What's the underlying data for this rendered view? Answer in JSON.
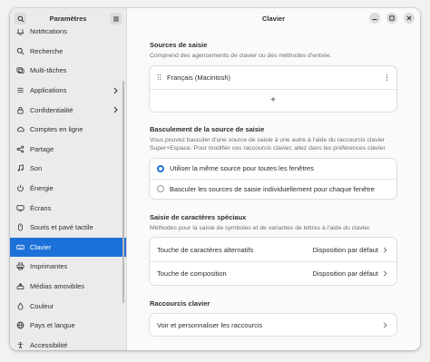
{
  "sidebar": {
    "title": "Paramètres",
    "items": [
      {
        "label": "Notifications",
        "icon": "bell-icon",
        "chevron": false
      },
      {
        "label": "Recherche",
        "icon": "search-icon",
        "chevron": false
      },
      {
        "label": "Multi-tâches",
        "icon": "multitasking-icon",
        "chevron": false
      },
      {
        "label": "Applications",
        "icon": "apps-icon",
        "chevron": true
      },
      {
        "label": "Confidentialité",
        "icon": "lock-icon",
        "chevron": true
      },
      {
        "label": "Comptes en ligne",
        "icon": "online-accounts-icon",
        "chevron": false
      },
      {
        "label": "Partage",
        "icon": "share-icon",
        "chevron": false
      },
      {
        "label": "Son",
        "icon": "music-note-icon",
        "chevron": false
      },
      {
        "label": "Énergie",
        "icon": "power-icon",
        "chevron": false
      },
      {
        "label": "Écrans",
        "icon": "display-icon",
        "chevron": false
      },
      {
        "label": "Souris et pavé tactile",
        "icon": "mouse-icon",
        "chevron": false
      },
      {
        "label": "Clavier",
        "icon": "keyboard-icon",
        "chevron": false,
        "active": true
      },
      {
        "label": "Imprimantes",
        "icon": "printer-icon",
        "chevron": false
      },
      {
        "label": "Médias amovibles",
        "icon": "removable-media-icon",
        "chevron": false
      },
      {
        "label": "Couleur",
        "icon": "color-icon",
        "chevron": false
      },
      {
        "label": "Pays et langue",
        "icon": "globe-icon",
        "chevron": false
      },
      {
        "label": "Accessibilité",
        "icon": "accessibility-icon",
        "chevron": false
      }
    ]
  },
  "header": {
    "title": "Clavier"
  },
  "sources": {
    "title": "Sources de saisie",
    "desc": "Comprend des agencements de clavier ou des méthodes d'entrée.",
    "item": "Français (Macintosh)",
    "add": "+"
  },
  "switching": {
    "title": "Basculement de la source de saisie",
    "desc": "Vous pouvez basculer d'une source de saisie à une autre à l'aide du raccourcis clavier Super+Espace. Pour modifier ces raccourcis clavier, allez dans les préférences clavier",
    "opt1": "Utiliser la même source pour toutes les fenêtres",
    "opt2": "Basculer les sources de saisie individuellement pour chaque fenêtre",
    "selected": 1
  },
  "special": {
    "title": "Saisie de caractères spéciaux",
    "desc": "Méthodes pour la saisie de symboles et de variantes de lettres à l'aide du clavier.",
    "alt_label": "Touche de caractères alternatifs",
    "alt_value": "Disposition par défaut",
    "compose_label": "Touche de composition",
    "compose_value": "Disposition par défaut"
  },
  "shortcuts": {
    "title": "Raccourcis clavier",
    "row": "Voir et personnaliser les raccourcis"
  },
  "colors": {
    "accent": "#1c71d8"
  }
}
